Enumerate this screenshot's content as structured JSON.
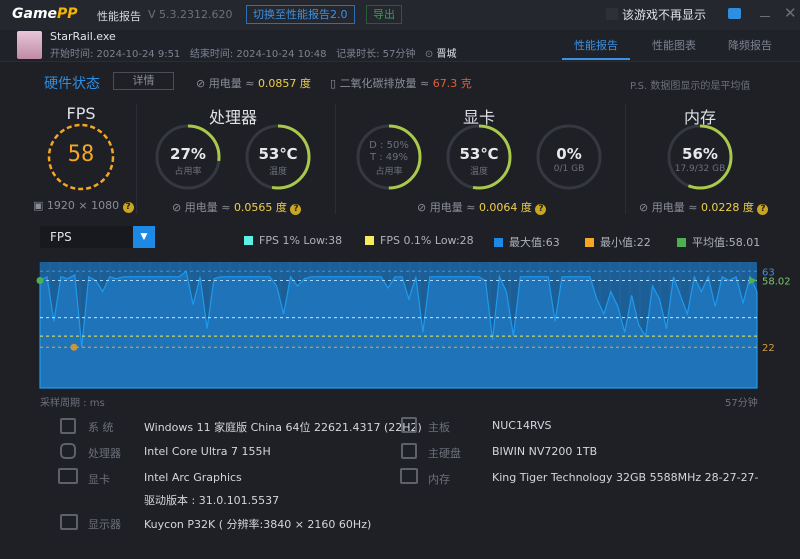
{
  "app": {
    "logo": "GamePP",
    "title": "性能报告",
    "version": "V 5.3.2312.620",
    "switch_label": "切换至性能报告2.0",
    "export_label": "导出",
    "hide_game_label": "该游戏不再显示"
  },
  "session": {
    "exe": "StarRail.exe",
    "start": "开始时间: 2024-10-24 9:51",
    "end": "结束时间: 2024-10-24 10:48",
    "duration": "记录时长: 57分钟",
    "location": "晋城"
  },
  "tabs": [
    {
      "label": "性能报告",
      "active": true
    },
    {
      "label": "性能图表"
    },
    {
      "label": "降频报告"
    }
  ],
  "hw": {
    "title": "硬件状态",
    "detail": "详情",
    "power": "用电量 ≈ ",
    "power_val": "0.0857 度",
    "co2": "二氧化碳排放量 ≈ ",
    "co2_val": "67.3 克",
    "note": "P.S. 数据图显示的是平均值"
  },
  "gauges": {
    "fps": {
      "title": "FPS",
      "value": "58",
      "resolution": "1920 × 1080"
    },
    "cpu": {
      "title": "处理器",
      "usage": "27%",
      "usage_label": "占用率",
      "usage_pct": 27,
      "temp": "53℃",
      "temp_label": "温度",
      "temp_pct": 53,
      "power": "用电量 ≈ ",
      "power_val": "0.0565 度"
    },
    "gpu": {
      "title": "显卡",
      "d": "D : 50%",
      "t": "T : 49%",
      "usage_label": "占用率",
      "usage_pct": 50,
      "temp": "53℃",
      "temp_label": "温度",
      "temp_pct": 53,
      "vram": "0%",
      "vram_label": "0/1 GB",
      "vram_pct": 0,
      "power": "用电量 ≈ ",
      "power_val": "0.0064 度"
    },
    "mem": {
      "title": "内存",
      "usage": "56%",
      "usage_label": "17.9/32 GB",
      "usage_pct": 56,
      "power": "用电量 ≈ ",
      "power_val": "0.0228 度"
    }
  },
  "colors": {
    "accent": "#3b92e4",
    "arc": "#a8c94a",
    "fps": "#f5a623",
    "line": "#1e9af0",
    "low1": "#5ef0e6",
    "low01": "#f4ec5a",
    "max": "#1e88e5",
    "min": "#f5a623",
    "avg": "#4caf50"
  },
  "chart_select": "FPS",
  "legend": [
    "FPS 1% Low:38",
    "FPS 0.1% Low:28",
    "最大值:63",
    "最小值:22",
    "平均值:58.01"
  ],
  "chart_data": {
    "type": "area",
    "metric": "FPS",
    "ylim": [
      0,
      68
    ],
    "max": 63,
    "min": 22,
    "avg": 58.02,
    "low1": 38,
    "low01": 28,
    "right_labels": [
      "63",
      "58.02",
      "22"
    ],
    "xlabel_left": "采样周期 : ms",
    "xlabel_right": "57分钟",
    "values": [
      58,
      60,
      36,
      60,
      59,
      61,
      22,
      60,
      58,
      52,
      60,
      59,
      60,
      60,
      60,
      60,
      60,
      60,
      60,
      60,
      60,
      63,
      45,
      60,
      32,
      59,
      60,
      60,
      60,
      60,
      60,
      60,
      60,
      60,
      55,
      40,
      60,
      55,
      59,
      60,
      60,
      60,
      60,
      60,
      60,
      60,
      60,
      60,
      60,
      60,
      54,
      60,
      60,
      48,
      60,
      30,
      60,
      60,
      60,
      60,
      60,
      60,
      60,
      60,
      58,
      26,
      60,
      52,
      28,
      60,
      60,
      60,
      60,
      60,
      36,
      60,
      60,
      60,
      60,
      60,
      48,
      40,
      52,
      44,
      30,
      50,
      34,
      28,
      55,
      48,
      32,
      60,
      50,
      40,
      60,
      52,
      60,
      44,
      60,
      58,
      60,
      46,
      60,
      52
    ]
  },
  "info": {
    "os": {
      "label": "系  统",
      "value": "Windows 11 家庭版 China 64位 22621.4317 (22H2)"
    },
    "cpu": {
      "label": "处理器",
      "value": "Intel Core Ultra 7 155H"
    },
    "gpu": {
      "label": "显卡",
      "value": "Intel Arc Graphics",
      "driver": "驱动版本 : 31.0.101.5537"
    },
    "monitor": {
      "label": "显示器",
      "value": "Kuycon P32K ( 分辨率:3840 × 2160 60Hz)"
    },
    "board": {
      "label": "主板",
      "value": "NUC14RVS"
    },
    "disk": {
      "label": "主硬盘",
      "value": "BIWIN NV7200 1TB"
    },
    "ram": {
      "label": "内存",
      "value": "King Tiger Technology 32GB 5588MHz 28-27-27-"
    }
  }
}
